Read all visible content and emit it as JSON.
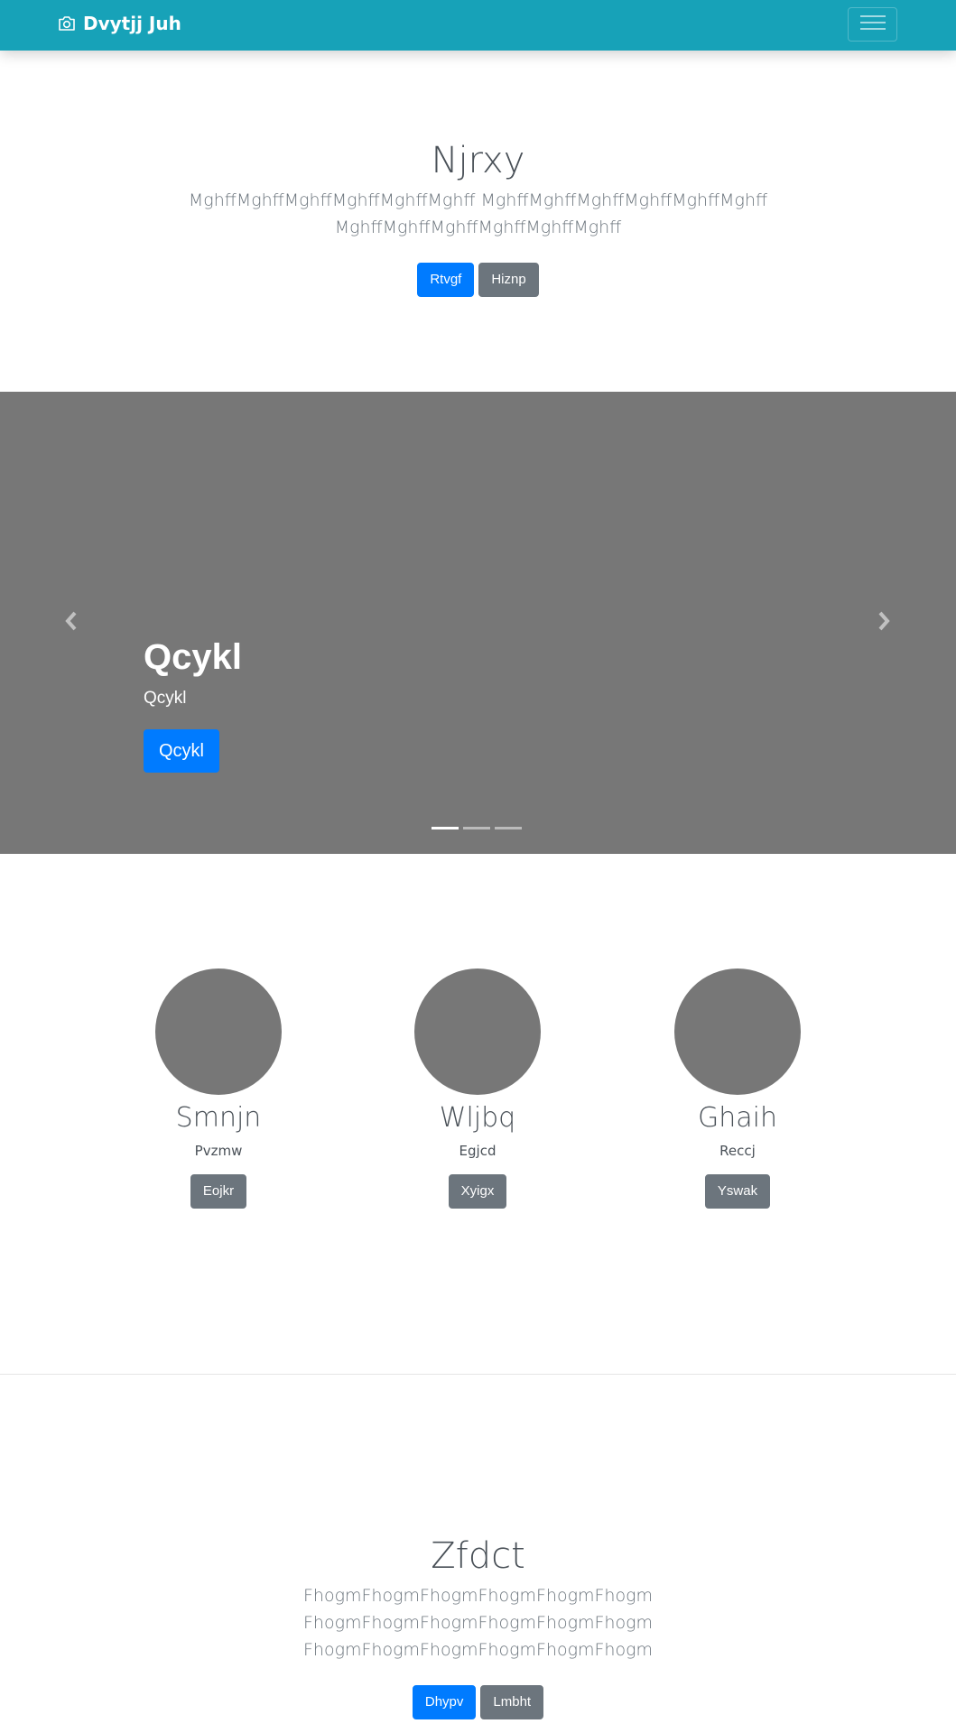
{
  "navbar": {
    "brand": "Dvytjj Juh",
    "brand_icon": "camera-icon",
    "toggler_icon": "hamburger-icon",
    "color": "#17a2b8"
  },
  "hero": {
    "title": "Njrxy",
    "lead_line1": "MghffMghffMghffMghffMghffMghff MghffMghffMghffMghffMghffMghff",
    "lead_line2": "MghffMghffMghffMghffMghffMghff",
    "primary_button": "Rtvgf",
    "secondary_button": "Hiznp"
  },
  "carousel": {
    "caption_title": "Qcykl",
    "caption_text": "Qcykl",
    "caption_button": "Qcykl",
    "prev_icon": "chevron-left-icon",
    "next_icon": "chevron-right-icon",
    "slides_count": 3,
    "active_index": 0,
    "background": "#777777"
  },
  "team": {
    "members": [
      {
        "name": "Smnjn",
        "role": "Pvzmw",
        "button": "Eojkr"
      },
      {
        "name": "Wljbq",
        "role": "Egjcd",
        "button": "Xyigx"
      },
      {
        "name": "Ghaih",
        "role": "Reccj",
        "button": "Yswak"
      }
    ]
  },
  "footer_section": {
    "title": "Zfdct",
    "lead_lines": [
      "FhogmFhogmFhogmFhogmFhogmFhogm",
      "FhogmFhogmFhogmFhogmFhogmFhogm",
      "FhogmFhogmFhogmFhogmFhogmFhogm"
    ],
    "primary_button": "Dhypv",
    "secondary_button": "Lmbht"
  },
  "colors": {
    "primary": "#007bff",
    "secondary": "#6c757d",
    "placeholder": "#777777"
  }
}
